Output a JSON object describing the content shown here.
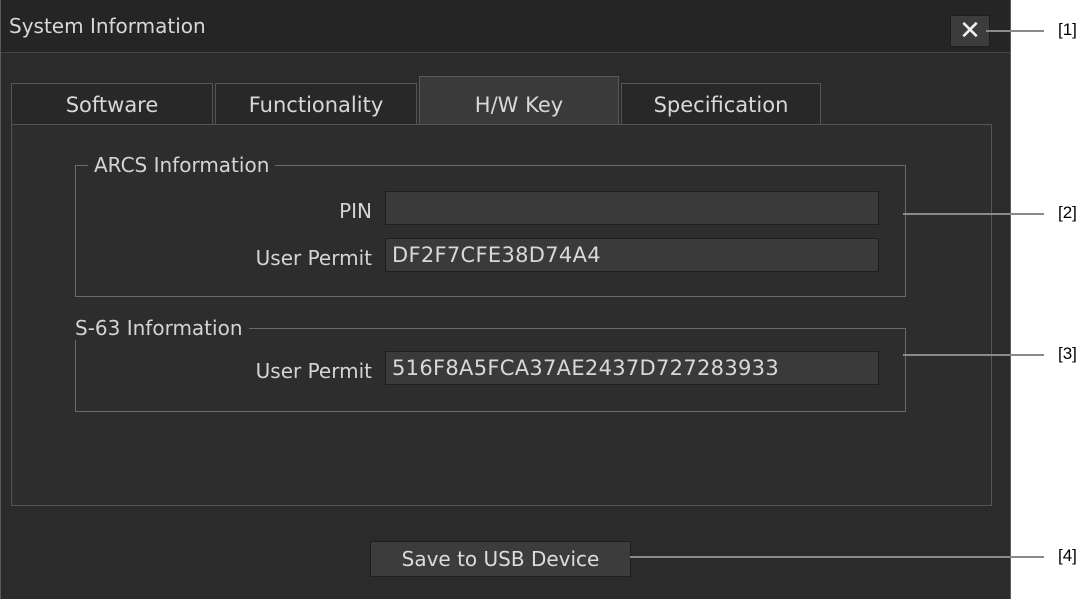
{
  "window": {
    "title": "System Information"
  },
  "tabs": [
    {
      "label": "Software"
    },
    {
      "label": "Functionality"
    },
    {
      "label": "H/W Key"
    },
    {
      "label": "Specification"
    }
  ],
  "active_tab": "H/W Key",
  "arcs": {
    "group_label": "ARCS Information",
    "pin_label": "PIN",
    "pin_value": "",
    "user_permit_label": "User Permit",
    "user_permit_value": "DF2F7CFE38D74A4"
  },
  "s63": {
    "group_label": "S-63 Information",
    "user_permit_label": "User Permit",
    "user_permit_value": "516F8A5FCA37AE2437D727283933"
  },
  "actions": {
    "save_usb_label": "Save to USB Device"
  },
  "callouts": [
    "[1]",
    "[2]",
    "[3]",
    "[4]"
  ],
  "icons": {
    "close": "close-icon"
  },
  "colors": {
    "background": "#2b2b2b",
    "text": "#d8d8d8",
    "field": "#3a3a3a"
  }
}
